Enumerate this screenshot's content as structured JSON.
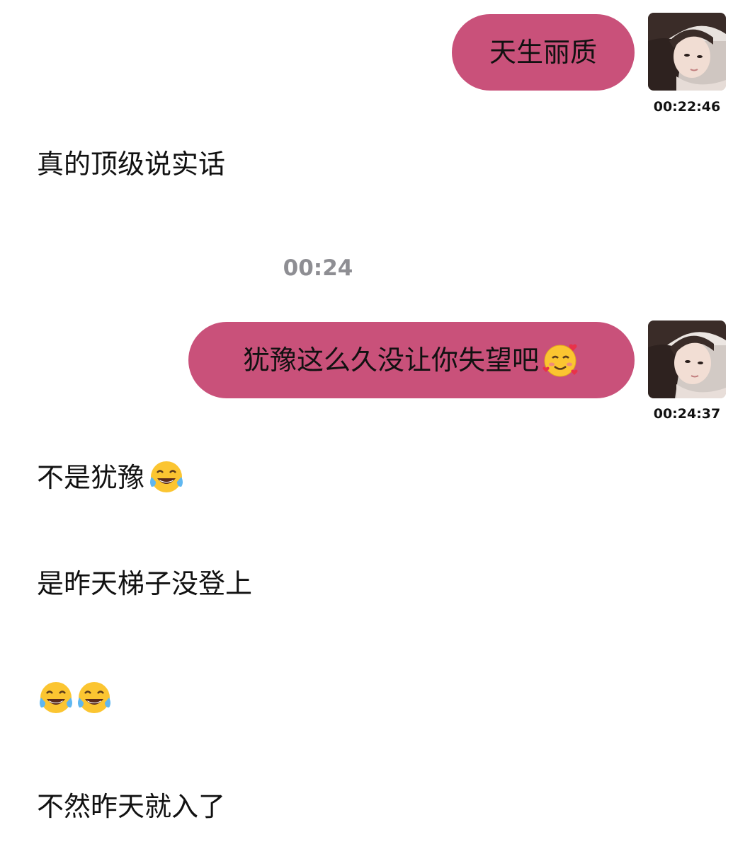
{
  "messages": {
    "m1": {
      "text": "天生丽质",
      "time": "00:22:46"
    },
    "m2": {
      "text": "真的顶级说实话"
    },
    "divider_time": "00:24",
    "m3": {
      "text": "犹豫这么久没让你失望吧",
      "emoji": "smiling-face-with-hearts-emoji",
      "time": "00:24:37"
    },
    "m4": {
      "text": "不是犹豫",
      "emoji": "tears-of-joy-emoji"
    },
    "m5": {
      "text": "是昨天梯子没登上"
    },
    "m6": {
      "emoji": [
        "tears-of-joy-emoji",
        "tears-of-joy-emoji"
      ]
    },
    "m7": {
      "text": "不然昨天就入了"
    }
  },
  "colors": {
    "sent_bubble": "#c9517a",
    "timestamp_gray": "#8e8e93",
    "background": "#ffffff"
  }
}
